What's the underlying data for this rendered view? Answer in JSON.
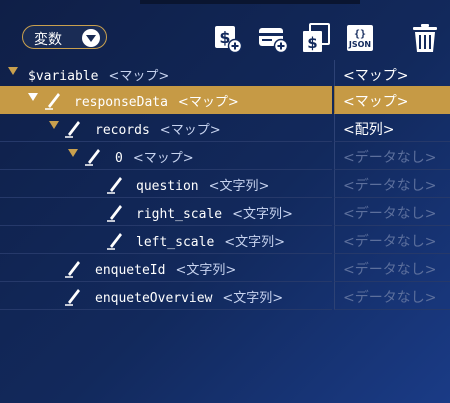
{
  "toolbar": {
    "dropdown_label": "変数",
    "tools": [
      {
        "name": "add-variable-button",
        "icon": "dollar-add-icon"
      },
      {
        "name": "add-object-button",
        "icon": "card-add-icon"
      },
      {
        "name": "copy-variable-button",
        "icon": "copy-dollar-icon"
      },
      {
        "name": "json-button",
        "icon": "json-icon",
        "label": "JSON"
      },
      {
        "name": "delete-button",
        "icon": "trash-icon"
      }
    ]
  },
  "tree": {
    "rows": [
      {
        "name": "$variable",
        "type": "<マップ>",
        "value": "<マップ>",
        "value_state": "filled"
      },
      {
        "name": "responseData",
        "type": "<マップ>",
        "value": "<マップ>",
        "value_state": "filled",
        "selected": true
      },
      {
        "name": "records",
        "type": "<マップ>",
        "value": "<配列>",
        "value_state": "filled"
      },
      {
        "name": "0",
        "type": "<マップ>",
        "value": "<データなし>",
        "value_state": "empty"
      },
      {
        "name": "question",
        "type": "<文字列>",
        "value": "<データなし>",
        "value_state": "empty"
      },
      {
        "name": "right_scale",
        "type": "<文字列>",
        "value": "<データなし>",
        "value_state": "empty"
      },
      {
        "name": "left_scale",
        "type": "<文字列>",
        "value": "<データなし>",
        "value_state": "empty"
      },
      {
        "name": "enqueteId",
        "type": "<文字列>",
        "value": "<データなし>",
        "value_state": "empty"
      },
      {
        "name": "enqueteOverview",
        "type": "<文字列>",
        "value": "<データなし>",
        "value_state": "empty"
      }
    ]
  },
  "colors": {
    "accent": "#c9a04e",
    "selected_row": "#c69a45",
    "background": "#12295c",
    "empty_value": "#5c6f9c"
  }
}
